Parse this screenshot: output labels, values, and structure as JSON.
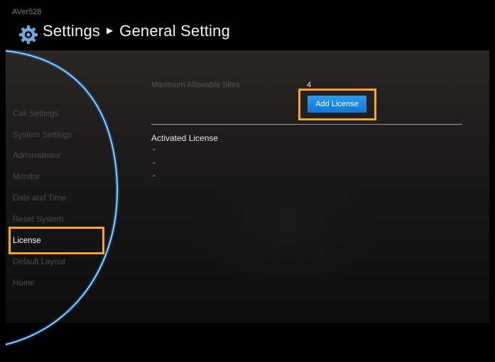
{
  "device_name": "AVer528",
  "header": {
    "section": "Settings",
    "separator": "►",
    "page": "General Setting"
  },
  "sidebar": {
    "items": [
      {
        "label": "Call Settings",
        "active": false
      },
      {
        "label": "System Settings",
        "active": false
      },
      {
        "label": "Administrator",
        "active": false
      },
      {
        "label": "Monitor",
        "active": false
      },
      {
        "label": "Date and Time",
        "active": false
      },
      {
        "label": "Reset System",
        "active": false
      },
      {
        "label": "License",
        "active": true
      },
      {
        "label": "Default Layout",
        "active": false
      },
      {
        "label": "Home",
        "active": false
      }
    ]
  },
  "main": {
    "max_sites_label": "Maximum Allowable Sites",
    "max_sites_value": "4",
    "add_license_label": "Add License",
    "activated_title": "Activated License",
    "activated_entries": [
      "-",
      "-",
      "-"
    ]
  },
  "colors": {
    "highlight": "#f5a623",
    "button": "#1a88e6",
    "arc": "#3aa0ff"
  },
  "icons": {
    "settings": "gear-icon"
  }
}
